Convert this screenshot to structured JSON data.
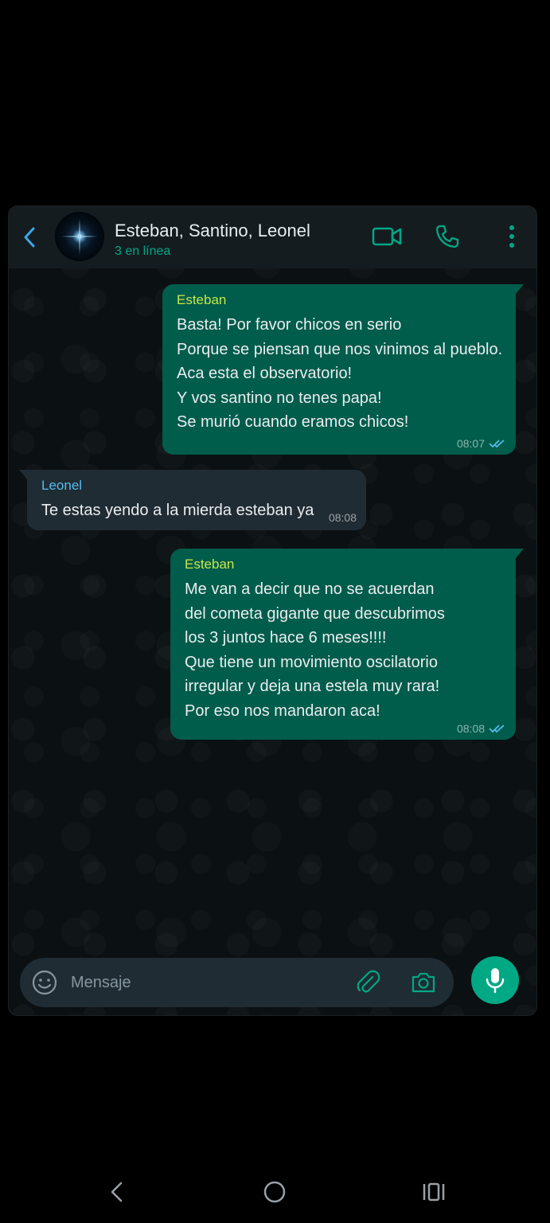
{
  "header": {
    "title": "Esteban, Santino, Leonel",
    "subtitle": "3 en línea"
  },
  "messages": [
    {
      "direction": "out",
      "sender": "Esteban",
      "lines": [
        "Basta! Por favor chicos en serio",
        "Porque se piensan que nos vinimos al pueblo.",
        "Aca esta el observatorio!",
        "Y vos santino no tenes papa!",
        "Se murió cuando eramos chicos!"
      ],
      "time": "08:07",
      "status": "read-double-check-icon"
    },
    {
      "direction": "in",
      "sender": "Leonel",
      "lines": [
        "Te estas yendo a la mierda esteban ya"
      ],
      "time": "08:08"
    },
    {
      "direction": "out",
      "sender": "Esteban",
      "lines": [
        "Me van a decir que no se acuerdan",
        "del cometa gigante que descubrimos",
        "los 3 juntos hace 6 meses!!!!",
        "Que tiene un movimiento oscilatorio",
        "irregular y deja una estela muy rara!",
        "Por eso nos mandaron aca!"
      ],
      "time": "08:08",
      "status": "read-double-check-icon"
    }
  ],
  "input": {
    "placeholder": "Mensaje",
    "value": ""
  },
  "icons": {
    "back": "back-arrow-icon",
    "video": "video-call-icon",
    "call": "phone-icon",
    "menu": "more-vert-icon",
    "emoji": "emoji-icon",
    "attach": "paperclip-icon",
    "camera": "camera-icon",
    "mic": "microphone-icon",
    "nav_back": "nav-back-icon",
    "nav_home": "nav-home-icon",
    "nav_recents": "nav-recents-icon"
  },
  "colors": {
    "accent": "#00a884",
    "outgoing_bubble": "#005c4b",
    "incoming_bubble": "#202c33",
    "esteban_name": "#c5e84a",
    "leonel_name": "#53bdeb",
    "read_ticks": "#53bdeb"
  }
}
